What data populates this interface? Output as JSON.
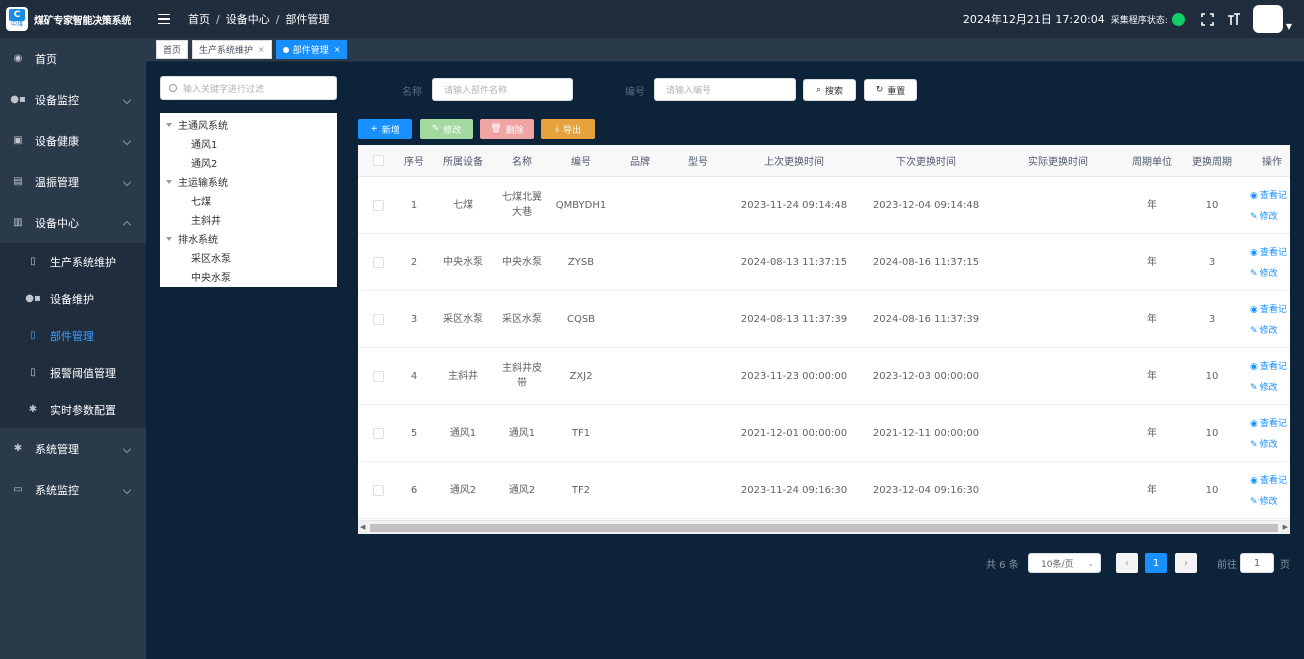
{
  "header": {
    "app_title": "煤矿专家智能决策系统",
    "logo_text": "中煤",
    "breadcrumb": [
      "首页",
      "设备中心",
      "部件管理"
    ],
    "datetime": "2024年12月21日 17:20:04",
    "status_label": "采集程序状态:",
    "status_color": "#13ce66"
  },
  "sidebar": {
    "items": [
      {
        "label": "首页",
        "icon": "dashboard-icon"
      },
      {
        "label": "设备监控",
        "icon": "monitor-icon"
      },
      {
        "label": "设备健康",
        "icon": "health-icon"
      },
      {
        "label": "温振管理",
        "icon": "chart-icon"
      },
      {
        "label": "设备中心",
        "icon": "equipment-icon"
      },
      {
        "label": "系统管理",
        "icon": "gear-icon"
      },
      {
        "label": "系统监控",
        "icon": "screen-icon"
      }
    ],
    "sub_items": [
      {
        "label": "生产系统维护",
        "icon": "document-icon"
      },
      {
        "label": "设备维护",
        "icon": "device-icon"
      },
      {
        "label": "部件管理",
        "icon": "document-icon"
      },
      {
        "label": "报警阈值管理",
        "icon": "document-icon"
      },
      {
        "label": "实时参数配置",
        "icon": "gear-icon"
      }
    ]
  },
  "tags": [
    {
      "label": "首页"
    },
    {
      "label": "生产系统维护"
    },
    {
      "label": "部件管理"
    }
  ],
  "tree": {
    "search_placeholder": "输入关键字进行过滤",
    "nodes": [
      {
        "label": "主通风系统",
        "level": 1
      },
      {
        "label": "通风1",
        "level": 2
      },
      {
        "label": "通风2",
        "level": 2
      },
      {
        "label": "主运输系统",
        "level": 1
      },
      {
        "label": "七煤",
        "level": 2
      },
      {
        "label": "主斜井",
        "level": 2
      },
      {
        "label": "排水系统",
        "level": 1
      },
      {
        "label": "采区水泵",
        "level": 2
      },
      {
        "label": "中央水泵",
        "level": 2
      }
    ]
  },
  "search": {
    "name_label": "名称",
    "name_placeholder": "请输入部件名称",
    "code_label": "编号",
    "code_placeholder": "请输入编号",
    "search_btn": "搜索",
    "reset_btn": "重置"
  },
  "actions": {
    "add": "新增",
    "edit": "修改",
    "delete": "删除",
    "export": "导出",
    "colors": {
      "add": "#1890ff",
      "edit": "#a3d9a0",
      "delete": "#f0a4a4",
      "export": "#e6a23c"
    }
  },
  "table": {
    "columns": [
      "序号",
      "所属设备",
      "名称",
      "编号",
      "品牌",
      "型号",
      "上次更换时间",
      "下次更换时间",
      "实际更换时间",
      "周期单位",
      "更换周期",
      "操作"
    ],
    "rows": [
      {
        "no": "1",
        "device": "七煤",
        "name": "七煤北翼大巷",
        "code": "QMBYDH1",
        "brand": "",
        "model": "",
        "last": "2023-11-24 09:14:48",
        "next": "2023-12-04 09:14:48",
        "actual": "",
        "unit": "年",
        "period": "10"
      },
      {
        "no": "2",
        "device": "中央水泵",
        "name": "中央水泵",
        "code": "ZYSB",
        "brand": "",
        "model": "",
        "last": "2024-08-13 11:37:15",
        "next": "2024-08-16 11:37:15",
        "actual": "",
        "unit": "年",
        "period": "3"
      },
      {
        "no": "3",
        "device": "采区水泵",
        "name": "采区水泵",
        "code": "CQSB",
        "brand": "",
        "model": "",
        "last": "2024-08-13 11:37:39",
        "next": "2024-08-16 11:37:39",
        "actual": "",
        "unit": "年",
        "period": "3"
      },
      {
        "no": "4",
        "device": "主斜井",
        "name": "主斜井皮带",
        "code": "ZXJ2",
        "brand": "",
        "model": "",
        "last": "2023-11-23 00:00:00",
        "next": "2023-12-03 00:00:00",
        "actual": "",
        "unit": "年",
        "period": "10"
      },
      {
        "no": "5",
        "device": "通风1",
        "name": "通风1",
        "code": "TF1",
        "brand": "",
        "model": "",
        "last": "2021-12-01 00:00:00",
        "next": "2021-12-11 00:00:00",
        "actual": "",
        "unit": "年",
        "period": "10"
      },
      {
        "no": "6",
        "device": "通风2",
        "name": "通风2",
        "code": "TF2",
        "brand": "",
        "model": "",
        "last": "2023-11-24 09:16:30",
        "next": "2023-12-04 09:16:30",
        "actual": "",
        "unit": "年",
        "period": "10"
      }
    ],
    "op_view": "查看记",
    "op_edit": "修改"
  },
  "pagination": {
    "total": "共 6 条",
    "page_size": "10条/页",
    "current_page": "1",
    "goto_label": "前往",
    "goto_value": "1",
    "page_suffix": "页"
  }
}
